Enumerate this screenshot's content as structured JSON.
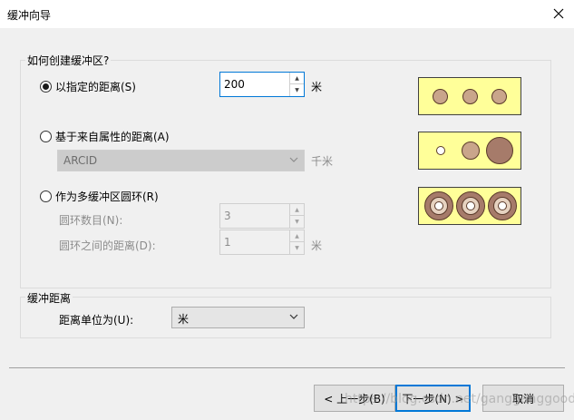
{
  "window": {
    "title": "缓冲向导"
  },
  "buffer_group": {
    "label": "如何创建缓冲区?",
    "option_distance": {
      "label": "以指定的距离(S)",
      "value": "200",
      "unit": "米",
      "checked": true
    },
    "option_attribute": {
      "label": "基于来自属性的距离(A)",
      "field_value": "ARCID",
      "unit": "千米",
      "checked": false
    },
    "option_multi_ring": {
      "label": "作为多缓冲区圆环(R)",
      "rings_label": "圆环数目(N):",
      "rings_value": "3",
      "ring_distance_label": "圆环之间的距离(D):",
      "ring_distance_value": "1",
      "ring_distance_unit": "米",
      "checked": false
    }
  },
  "units_group": {
    "label": "缓冲距离",
    "units_label": "距离单位为(U):",
    "units_value": "米"
  },
  "buttons": {
    "back": "< 上一步(B)",
    "next": "下一步(N) >",
    "cancel": "取消"
  },
  "watermark": "https://blog.csdn.net/gangganggood",
  "colors": {
    "preview_fill": "#ffff99",
    "circle_fill": "#c9a58b",
    "big_circle_fill": "#a67b6a",
    "accent": "#0078d7"
  },
  "icons": {
    "close": "close-icon",
    "spin_up": "spin-up-icon",
    "spin_down": "spin-down-icon",
    "dropdown": "chevron-down-icon"
  }
}
